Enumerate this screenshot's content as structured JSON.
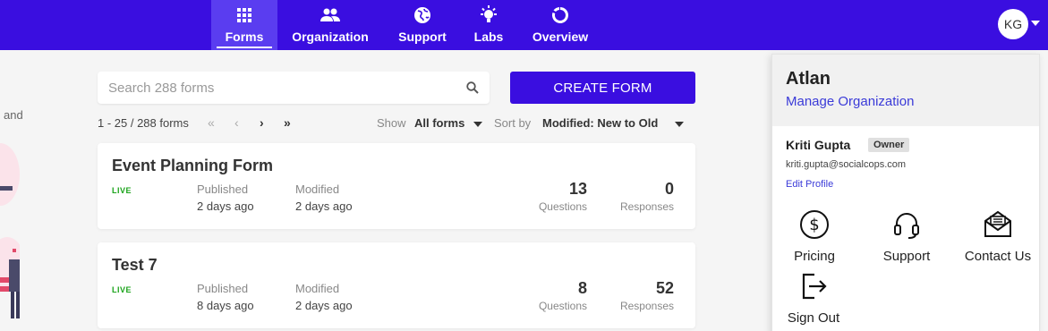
{
  "nav": {
    "items": [
      {
        "label": "Forms",
        "icon": "grid-icon",
        "active": true
      },
      {
        "label": "Organization",
        "icon": "people-icon"
      },
      {
        "label": "Support",
        "icon": "globe-icon"
      },
      {
        "label": "Labs",
        "icon": "lightbulb-icon"
      },
      {
        "label": "Overview",
        "icon": "donut-icon"
      }
    ],
    "avatar_initials": "KG"
  },
  "left_partial_text": "and",
  "search": {
    "placeholder": "Search 288 forms"
  },
  "create_button": "CREATE FORM",
  "pagination": {
    "text": "1 - 25 / 288 forms",
    "first": "«",
    "prev": "‹",
    "next": "›",
    "last": "»"
  },
  "filters": {
    "show_label": "Show",
    "show_value": "All forms",
    "sort_label": "Sort by",
    "sort_value": "Modified: New to Old"
  },
  "forms": [
    {
      "title": "Event Planning Form",
      "status": "LIVE",
      "published_label": "Published",
      "published": "2 days ago",
      "modified_label": "Modified",
      "modified": "2 days ago",
      "questions": "13",
      "questions_label": "Questions",
      "responses": "0",
      "responses_label": "Responses"
    },
    {
      "title": "Test 7",
      "status": "LIVE",
      "published_label": "Published",
      "published": "8 days ago",
      "modified_label": "Modified",
      "modified": "2 days ago",
      "questions": "8",
      "questions_label": "Questions",
      "responses": "52",
      "responses_label": "Responses"
    }
  ],
  "account_panel": {
    "org_name": "Atlan",
    "manage_link": "Manage Organization",
    "user_name": "Kriti Gupta",
    "role": "Owner",
    "email": "kriti.gupta@socialcops.com",
    "edit_profile": "Edit Profile",
    "actions": [
      {
        "label": "Pricing",
        "icon": "dollar-icon"
      },
      {
        "label": "Support",
        "icon": "headset-icon"
      },
      {
        "label": "Contact Us",
        "icon": "envelope-icon"
      },
      {
        "label": "Sign Out",
        "icon": "sign-out-icon"
      }
    ]
  },
  "colors": {
    "brand": "#3a0ee0",
    "live": "#1aa31a",
    "link": "#3a3ad8"
  }
}
